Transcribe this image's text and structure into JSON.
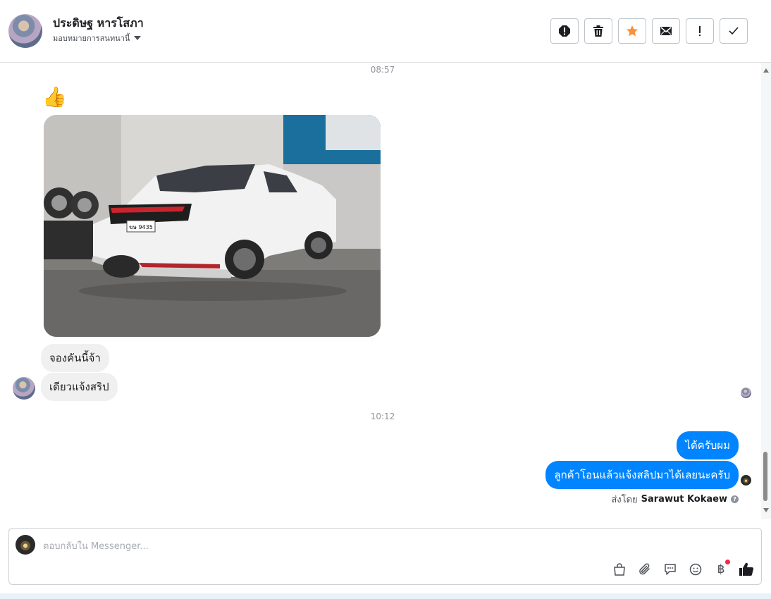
{
  "header": {
    "contact_name": "ประดิษฐ หารโสภา",
    "assign_label": "มอบหมายการสนทนานี้"
  },
  "chat": {
    "time_1": "08:57",
    "thumb_emoji": "👍",
    "plate_text": "ขษ 9435",
    "incoming_1": "จองคันนี้จ้า",
    "incoming_2": "เดียวแจ้งสริป",
    "time_2": "10:12",
    "outgoing_1": "ได้ครับผม",
    "outgoing_2": "ลูกค้าโอนแล้วแจ้งสลิปมาได้เลยนะครับ",
    "sent_by_prefix": "ส่งโดย",
    "sent_by_name": "Sarawut Kokaew"
  },
  "composer": {
    "placeholder": "ตอบกลับใน Messenger...",
    "baht_symbol": "฿"
  },
  "colors": {
    "outgoing_bubble": "#0084ff",
    "incoming_bubble": "#f1f0f0",
    "star": "#f7923a",
    "like": "#1c1e21"
  },
  "icons": {
    "actions": [
      "alert-circle-icon",
      "trash-icon",
      "star-icon",
      "envelope-icon",
      "exclamation-icon",
      "check-icon"
    ],
    "tools": [
      "bag-icon",
      "paperclip-icon",
      "speech-bubble-icon",
      "smiley-icon",
      "baht-icon",
      "thumbs-up-icon"
    ]
  }
}
